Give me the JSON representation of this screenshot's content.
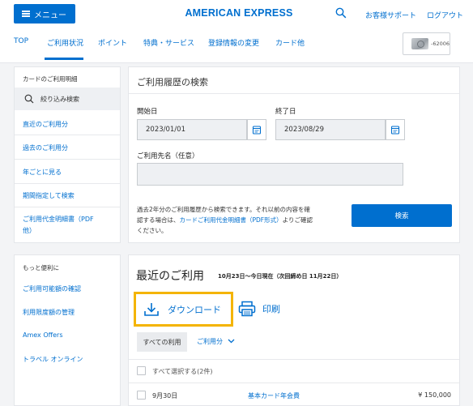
{
  "header": {
    "menu_label": "メニュー",
    "brand": "AMERICAN EXPRESS",
    "support": "お客様サポート",
    "logout": "ログアウト"
  },
  "nav": {
    "tabs": [
      "TOP",
      "ご利用状況",
      "ポイント",
      "特典・サービス",
      "登録情報の変更",
      "カード他"
    ],
    "active_tab": "ご利用状況",
    "card_number": "-62006"
  },
  "sidebar": {
    "section1_title": "カードのご利用明細",
    "filter_label": "絞り込み検索",
    "items": [
      "直近のご利用分",
      "過去のご利用分",
      "年ごとに見る",
      "期間指定して検索",
      "ご利用代金明細書（PDF",
      "他）"
    ],
    "section2_title": "もっと便利に",
    "items2": [
      "ご利用可能額の確認",
      "利用限度額の管理",
      "Amex Offers",
      "トラベル オンライン"
    ]
  },
  "search_panel": {
    "title": "ご利用履歴の検索",
    "start_label": "開始日",
    "start_value": "2023/01/01",
    "end_label": "終了日",
    "end_value": "2023/08/29",
    "merchant_label": "ご利用先名（任意）",
    "merchant_value": "",
    "note_line1": "過去2年分のご利用履歴から検索できます。それ以前の内容を確",
    "note_line2_a": "認する場合は、",
    "note_link": "カードご利用代金明細書（PDF形式）",
    "note_line2_b": "よりご確認",
    "note_line3": "ください。",
    "search_button": "検索"
  },
  "recent_panel": {
    "title": "最近のご利用",
    "period": "10月23日〜今日現在（次回締め日 11月22日）",
    "download": "ダウンロード",
    "print": "印刷",
    "tab_all": "すべての利用",
    "tab_usage": "ご利用分",
    "select_all": "すべて選択する(2件)",
    "rows": [
      {
        "date": "9月30日",
        "description": "基本カード年会費",
        "amount": "¥ 150,000"
      }
    ]
  },
  "colors": {
    "brand_blue": "#006fcf",
    "highlight": "#f4b400"
  }
}
